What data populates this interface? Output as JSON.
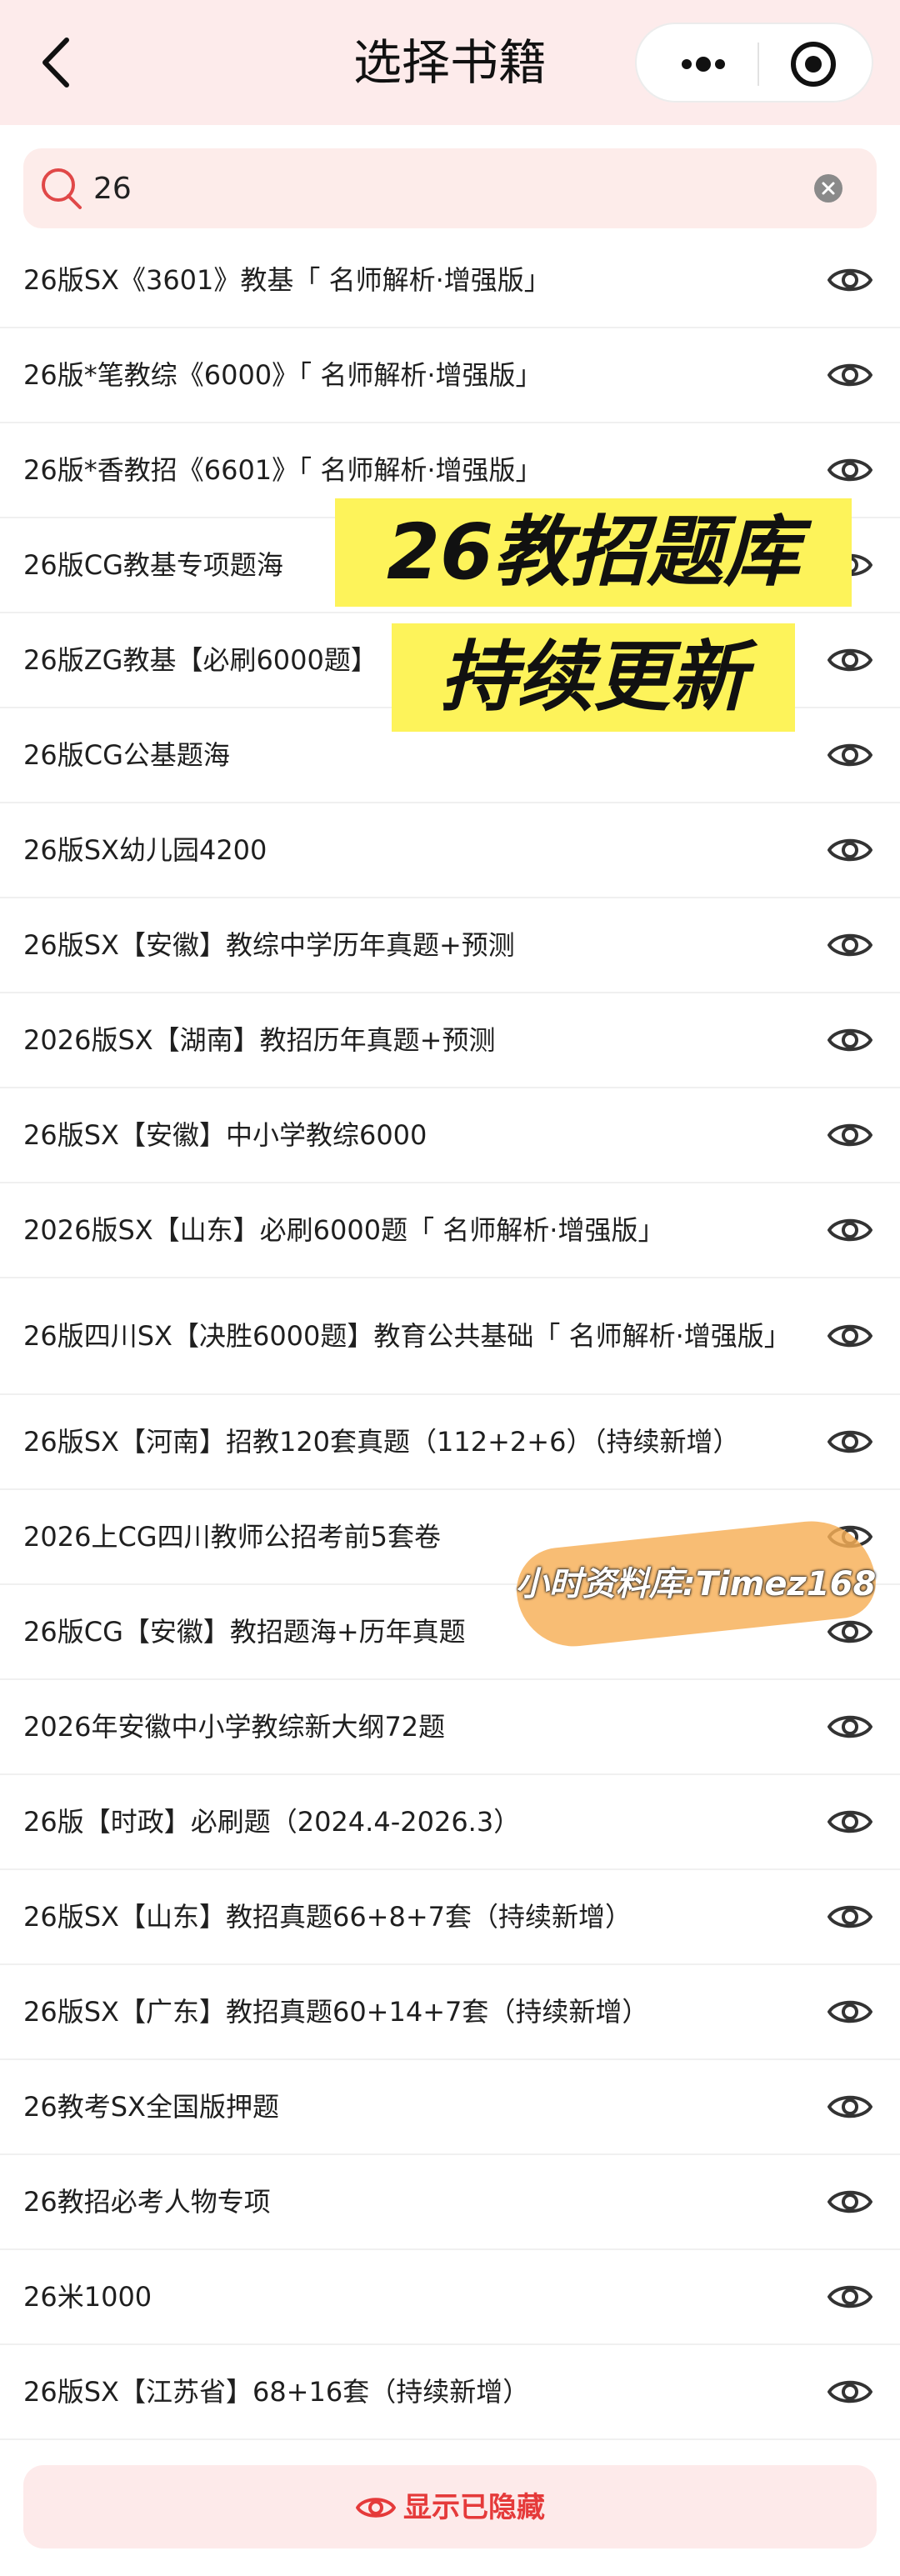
{
  "header": {
    "title": "选择书籍"
  },
  "search": {
    "value": "26",
    "placeholder": ""
  },
  "books": [
    {
      "title": "26版SX《3601》教基「 名师解析·增强版」"
    },
    {
      "title": "26版*笔教综《6000》「 名师解析·增强版」"
    },
    {
      "title": "26版*香教招《6601》「 名师解析·增强版」"
    },
    {
      "title": "26版CG教基专项题海"
    },
    {
      "title": "26版ZG教基【必刷6000题】"
    },
    {
      "title": "26版CG公基题海"
    },
    {
      "title": "26版SX幼儿园4200"
    },
    {
      "title": "26版SX【安徽】教综中学历年真题+预测"
    },
    {
      "title": "2026版SX【湖南】教招历年真题+预测"
    },
    {
      "title": "26版SX【安徽】中小学教综6000"
    },
    {
      "title": "2026版SX【山东】必刷6000题「 名师解析·增强版」"
    },
    {
      "title": "26版四川SX【决胜6000题】教育公共基础「 名师解析·增强版」"
    },
    {
      "title": "26版SX【河南】招教120套真题（112+2+6）（持续新增）"
    },
    {
      "title": "2026上CG四川教师公招考前5套卷"
    },
    {
      "title": "26版CG【安徽】教招题海+历年真题"
    },
    {
      "title": "2026年安徽中小学教综新大纲72题"
    },
    {
      "title": "26版【时政】必刷题（2024.4-2026.3）"
    },
    {
      "title": "26版SX【山东】教招真题66+8+7套（持续新增）"
    },
    {
      "title": "26版SX【广东】教招真题60+14+7套（持续新增）"
    },
    {
      "title": "26教考SX全国版押题"
    },
    {
      "title": "26教招必考人物专项"
    },
    {
      "title": "26米1000"
    },
    {
      "title": "26版SX【江苏省】68+16套（持续新增）"
    }
  ],
  "overlay": {
    "promo_line1": "26教招题库",
    "promo_line2": "持续更新",
    "watermark": "小时资料库:Timez168"
  },
  "footer": {
    "show_hidden_label": "显示已隐藏"
  },
  "colors": {
    "accent": "#e53a3a",
    "header_bg": "#fdebeb",
    "promo_bg": "#fdf35a",
    "watermark_bg": "#f6ae55"
  },
  "icons": {
    "back": "chevron-left-icon",
    "more": "more-dots-icon",
    "close": "target-close-icon",
    "search": "search-icon",
    "clear": "clear-circle-icon",
    "row_action": "eye-icon"
  }
}
